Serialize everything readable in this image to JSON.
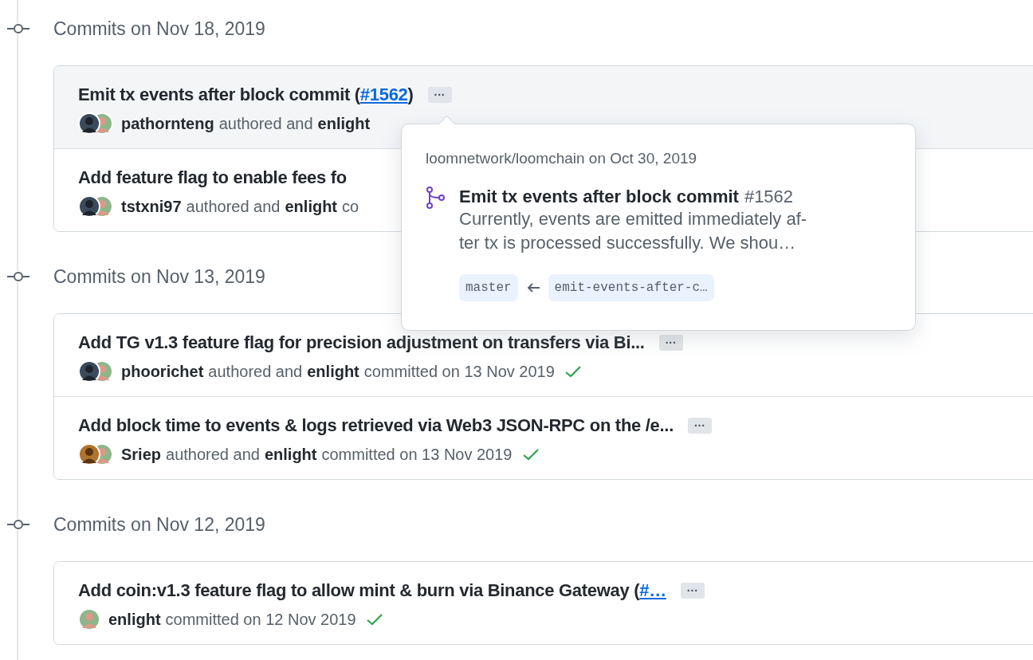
{
  "groups": [
    {
      "date": "Commits on Nov 18, 2019",
      "commits": [
        {
          "hovered": true,
          "title": "Emit tx events after block commit (",
          "link": "#1562",
          "tail": ")",
          "more": "···",
          "meta": [
            {
              "kind": "user",
              "text": "pathornteng"
            },
            {
              "kind": "text",
              "text": "authored and"
            },
            {
              "kind": "user",
              "text": "enlight"
            }
          ],
          "avatars": [
            {
              "kind": "dark"
            },
            {
              "kind": "light"
            }
          ]
        },
        {
          "hovered": false,
          "title": "Add feature flag to enable fees fo",
          "meta": [
            {
              "kind": "user",
              "text": "tstxni97"
            },
            {
              "kind": "text",
              "text": "authored and"
            },
            {
              "kind": "user",
              "text": "enlight"
            },
            {
              "kind": "text",
              "text": "co"
            }
          ],
          "avatars": [
            {
              "kind": "dark"
            },
            {
              "kind": "light"
            }
          ]
        }
      ]
    },
    {
      "date": "Commits on Nov 13, 2019",
      "commits": [
        {
          "hovered": false,
          "title": "Add TG v1.3 feature flag for precision adjustment on transfers via Bi...",
          "more": "···",
          "meta": [
            {
              "kind": "user",
              "text": "phoorichet"
            },
            {
              "kind": "text",
              "text": "authored and"
            },
            {
              "kind": "user",
              "text": "enlight"
            },
            {
              "kind": "text",
              "text": "committed on 13 Nov 2019"
            }
          ],
          "avatars": [
            {
              "kind": "dark"
            },
            {
              "kind": "light"
            }
          ],
          "verified": true
        },
        {
          "hovered": false,
          "title": "Add block time to events & logs retrieved via Web3 JSON-RPC on the /e...",
          "more": "···",
          "meta": [
            {
              "kind": "user",
              "text": "Sriep"
            },
            {
              "kind": "text",
              "text": "authored and"
            },
            {
              "kind": "user",
              "text": "enlight"
            },
            {
              "kind": "text",
              "text": "committed on 13 Nov 2019"
            }
          ],
          "avatars": [
            {
              "kind": "warm"
            },
            {
              "kind": "light"
            }
          ],
          "verified": true
        }
      ]
    },
    {
      "date": "Commits on Nov 12, 2019",
      "commits": [
        {
          "hovered": false,
          "title": "Add coin:v1.3 feature flag to allow mint & burn via Binance Gateway (",
          "link": "#…",
          "more": "···",
          "meta": [
            {
              "kind": "user",
              "text": "enlight"
            },
            {
              "kind": "text",
              "text": "committed on 12 Nov 2019"
            }
          ],
          "avatars": [
            {
              "kind": "light"
            }
          ],
          "verified": true
        }
      ]
    }
  ],
  "popover": {
    "repo": "loomnetwork/loomchain on Oct 30, 2019",
    "title": "Emit tx events after block commit",
    "number": "#1562",
    "body_lines": [
      "Currently, events are emitted immediately af-",
      "ter tx is processed successfully. We shou…"
    ],
    "base": "master",
    "head": "emit-events-after-c…"
  }
}
